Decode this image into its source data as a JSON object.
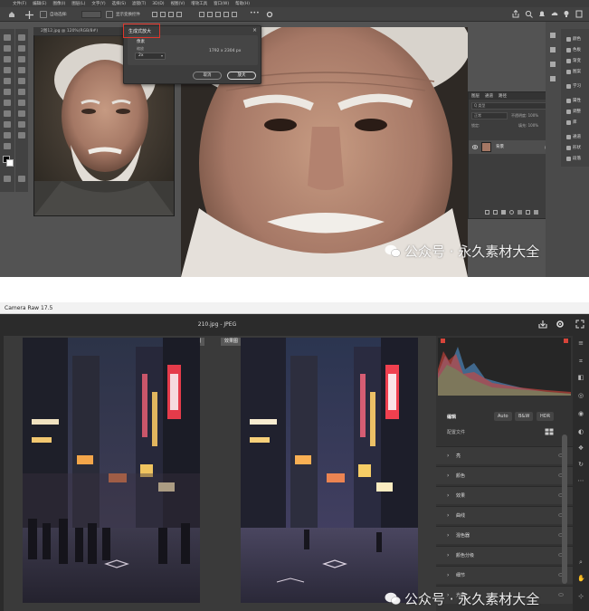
{
  "photoshop": {
    "menu_items": [
      "文件(F)",
      "编辑(E)",
      "图像(I)",
      "图层(L)",
      "文字(Y)",
      "选择(S)",
      "滤镜(T)",
      "3D(D)",
      "视图(V)",
      "增效工具",
      "窗口(W)",
      "帮助(H)"
    ],
    "options": {
      "auto_select_label": "自动选择:",
      "transform_label": "显示变换控件",
      "more_label": "•••"
    },
    "document_tab": "2图12.jpg @ 120%(RGB/8#)",
    "dialog": {
      "title": "生成式放大",
      "section_label": "像素",
      "scale_label": "缩放",
      "scale_value": "2x",
      "size_value": "1792 x 2304 px",
      "cancel_label": "取消",
      "ok_label": "放大"
    },
    "layers_panel": {
      "tabs": [
        "图层",
        "通道",
        "路径"
      ],
      "search_label": "Q 类型",
      "blend_mode": "正常",
      "opacity_label": "不透明度: 100%",
      "lock_label": "锁定:",
      "fill_label": "填充: 100%",
      "layer_name": "背景"
    },
    "right_panel_items": [
      "颜色",
      "色板",
      "渐变",
      "图案",
      "学习",
      "属性",
      "调整",
      "库",
      "通道",
      "形状",
      "段落"
    ]
  },
  "camera_raw": {
    "title": "Camera Raw 17.5",
    "filename": "210.jpg  -  JPEG",
    "before_label": "原图",
    "after_label": "效果图",
    "edit": {
      "title": "编辑",
      "auto_label": "Auto",
      "bw_label": "B&W",
      "hdr_label": "HDR",
      "profile_label": "配置文件"
    },
    "sections": [
      "亮",
      "颜色",
      "效果",
      "曲线",
      "混色器",
      "颜色分级",
      "细节",
      "光学"
    ]
  },
  "watermark_text": "公众号 · 永久素材大全",
  "colors": {
    "highlight": "#e0362b",
    "ps_bg": "#535353",
    "cr_bg": "#2b2b2b",
    "histogram_red": "#d7443a",
    "histogram_blue": "#4a7fb0"
  }
}
